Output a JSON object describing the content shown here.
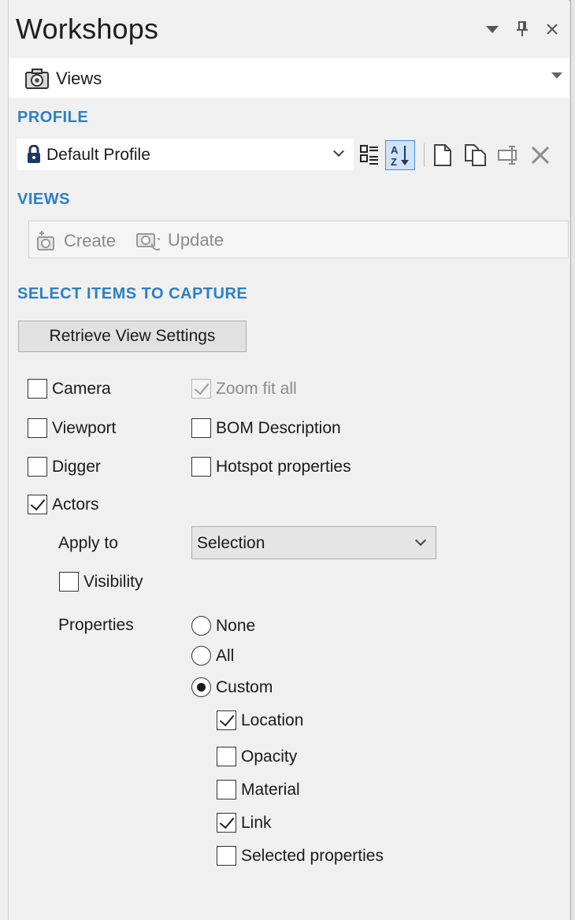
{
  "window": {
    "title": "Workshops",
    "controls": [
      {
        "name": "dropdown-icon",
        "glyph": "▾"
      },
      {
        "name": "pin-icon",
        "glyph": "📌"
      },
      {
        "name": "close-icon",
        "glyph": "✕"
      }
    ]
  },
  "workshop_selector": {
    "icon": "camera-icon",
    "label": "Views"
  },
  "profile": {
    "section_title": "PROFILE",
    "selected": "Default Profile",
    "lock_icon": "lock-icon",
    "toolbar": [
      {
        "name": "categorized-view-icon",
        "active": false
      },
      {
        "name": "sort-alphabetical-icon",
        "active": true
      },
      {
        "name": "new-profile-icon",
        "active": false
      },
      {
        "name": "duplicate-profile-icon",
        "active": false
      },
      {
        "name": "rename-profile-icon",
        "active": false
      },
      {
        "name": "delete-profile-icon",
        "active": false
      }
    ]
  },
  "views": {
    "section_title": "VIEWS",
    "create_label": "Create",
    "update_label": "Update"
  },
  "capture": {
    "section_title": "SELECT ITEMS TO CAPTURE",
    "retrieve_label": "Retrieve View Settings",
    "camera": {
      "label": "Camera",
      "checked": false
    },
    "zoom_fit_all": {
      "label": "Zoom fit all",
      "checked": true,
      "disabled": true
    },
    "viewport": {
      "label": "Viewport",
      "checked": false
    },
    "bom_description": {
      "label": "BOM Description",
      "checked": false
    },
    "digger": {
      "label": "Digger",
      "checked": false
    },
    "hotspot_properties": {
      "label": "Hotspot properties",
      "checked": false
    },
    "actors": {
      "label": "Actors",
      "checked": true
    },
    "apply_to": {
      "label": "Apply to",
      "value": "Selection"
    },
    "visibility": {
      "label": "Visibility",
      "checked": false
    },
    "properties": {
      "label": "Properties",
      "options": [
        "None",
        "All",
        "Custom"
      ],
      "selected": "Custom",
      "custom": {
        "location": {
          "label": "Location",
          "checked": true
        },
        "opacity": {
          "label": "Opacity",
          "checked": false
        },
        "material": {
          "label": "Material",
          "checked": false
        },
        "link": {
          "label": "Link",
          "checked": true
        },
        "selected_properties": {
          "label": "Selected properties",
          "checked": false
        }
      }
    }
  },
  "colors": {
    "section_title": "#2e7fc4",
    "panel_bg": "#f0f0f0",
    "active_toggle": "#cfe3f7"
  }
}
